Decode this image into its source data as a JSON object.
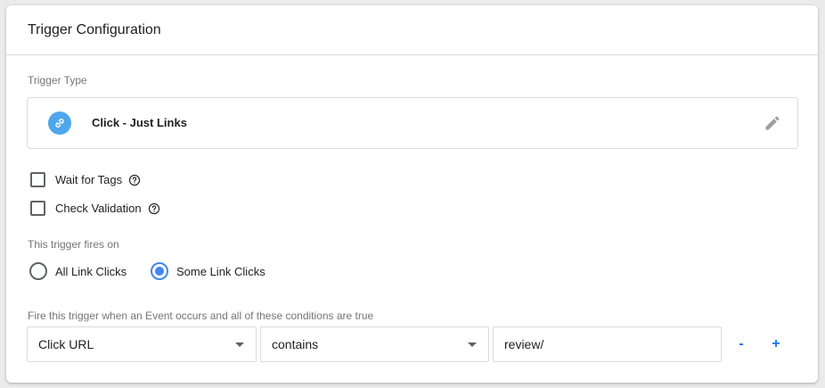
{
  "card": {
    "title": "Trigger Configuration"
  },
  "trigger_type": {
    "label": "Trigger Type",
    "name": "Click - Just Links",
    "icon": "link-icon",
    "icon_color": "#4ea7ec"
  },
  "options": [
    {
      "label": "Wait for Tags",
      "checked": false,
      "help_icon": "help-circle-icon"
    },
    {
      "label": "Check Validation",
      "checked": false,
      "help_icon": "help-circle-icon"
    }
  ],
  "fires_on": {
    "label": "This trigger fires on",
    "choices": [
      {
        "label": "All Link Clicks",
        "selected": false
      },
      {
        "label": "Some Link Clicks",
        "selected": true
      }
    ]
  },
  "condition": {
    "label": "Fire this trigger when an Event occurs and all of these conditions are true",
    "variable": "Click URL",
    "operator": "contains",
    "value": "review/",
    "remove_label": "-",
    "add_label": "+"
  },
  "colors": {
    "accent": "#4285f4",
    "link_blue": "#1a73e8"
  }
}
